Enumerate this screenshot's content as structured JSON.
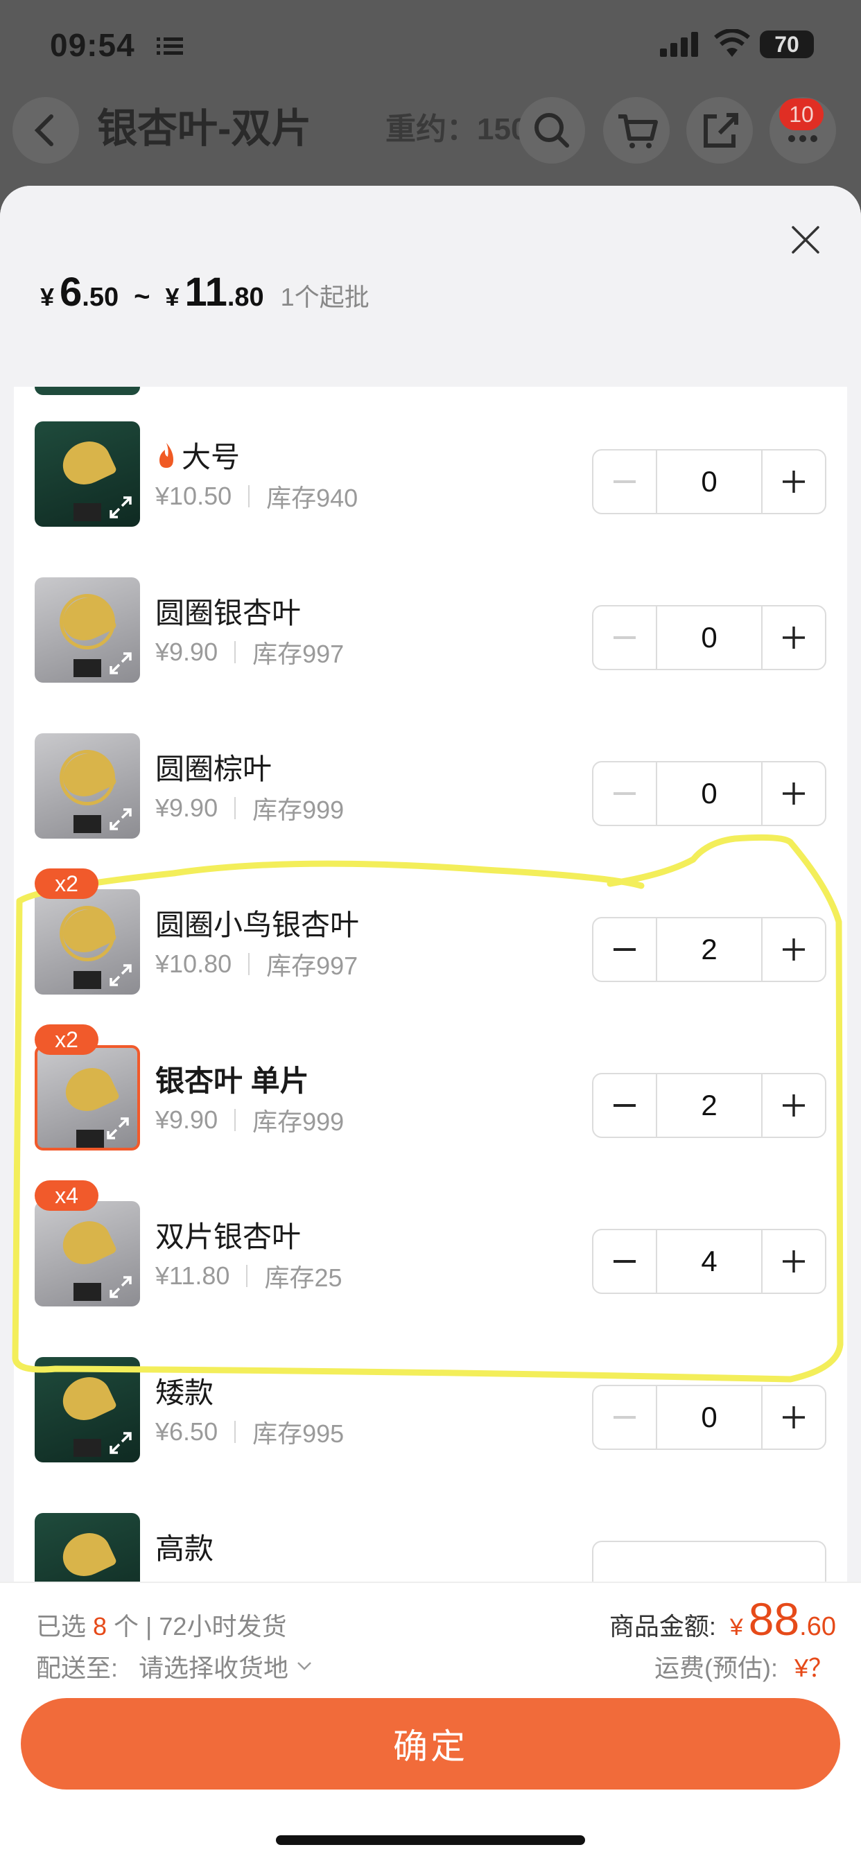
{
  "status_bar": {
    "time": "09:54",
    "battery": "70"
  },
  "background_header": {
    "title": "银杏叶-双片",
    "weight": "重约：150g",
    "cart_badge": "10"
  },
  "sheet": {
    "price_range": {
      "currency": "¥",
      "min_int": "6",
      "min_dec": ".50",
      "tilde": "~",
      "max_int": "11",
      "max_dec": ".80",
      "min_order": "1个起批"
    }
  },
  "items": [
    {
      "name": "大号",
      "price": "¥10.50",
      "stock": "库存940",
      "qty": "0",
      "badge": "",
      "style": "dark",
      "hot": true,
      "bold": false
    },
    {
      "name": "圆圈银杏叶",
      "price": "¥9.90",
      "stock": "库存997",
      "qty": "0",
      "badge": "",
      "style": "light",
      "hot": false,
      "bold": false
    },
    {
      "name": "圆圈棕叶",
      "price": "¥9.90",
      "stock": "库存999",
      "qty": "0",
      "badge": "",
      "style": "light",
      "hot": false,
      "bold": false
    },
    {
      "name": "圆圈小鸟银杏叶",
      "price": "¥10.80",
      "stock": "库存997",
      "qty": "2",
      "badge": "x2",
      "style": "light",
      "hot": false,
      "bold": false
    },
    {
      "name": "银杏叶 单片",
      "price": "¥9.90",
      "stock": "库存999",
      "qty": "2",
      "badge": "x2",
      "style": "light",
      "hot": false,
      "bold": true,
      "selected": true
    },
    {
      "name": "双片银杏叶",
      "price": "¥11.80",
      "stock": "库存25",
      "qty": "4",
      "badge": "x4",
      "style": "light",
      "hot": false,
      "bold": false
    },
    {
      "name": "矮款",
      "price": "¥6.50",
      "stock": "库存995",
      "qty": "0",
      "badge": "",
      "style": "dark",
      "hot": false,
      "bold": false
    },
    {
      "name": "高款",
      "price": "",
      "stock": "",
      "qty": "",
      "badge": "",
      "style": "dark",
      "hot": false,
      "bold": false
    }
  ],
  "footer": {
    "selected_prefix": "已选",
    "selected_count": "8",
    "selected_suffix": "个 | 72小时发货",
    "ship_label": "配送至:",
    "ship_value": "请选择收货地",
    "amount_label": "商品金额:",
    "amount_currency": "¥",
    "amount_int": "88",
    "amount_dec": ".60",
    "freight_label": "运费(预估):",
    "freight_value": "¥？",
    "confirm_label": "确定"
  },
  "colors": {
    "accent": "#f16b3a",
    "price_red": "#e64a19",
    "highlight_yellow": "#f3ee5a"
  }
}
